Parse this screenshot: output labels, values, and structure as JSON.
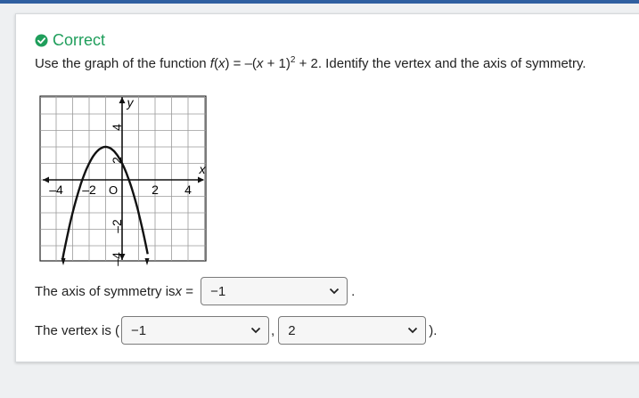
{
  "status": {
    "label": "Correct",
    "color": "#1f9e5b"
  },
  "question": {
    "prefix": "Use the graph of the function ",
    "func_name": "f",
    "func_arg": "x",
    "equals": " = –(",
    "inner_var": "x",
    "inner_rest": " + 1)",
    "exponent": "2",
    "suffix": " + 2. Identify the vertex and the axis of symmetry."
  },
  "graph": {
    "x_label": "x",
    "y_label": "y",
    "x_ticks": [
      "–4",
      "–2",
      "2",
      "4"
    ],
    "origin_label": "O",
    "y_ticks": [
      "4",
      "2",
      "–2",
      "–4"
    ]
  },
  "axis_sentence": {
    "prefix": "The axis of symmetry is ",
    "var": "x",
    "equals": " = ",
    "selected": "−1",
    "suffix": "."
  },
  "vertex_sentence": {
    "prefix": "The vertex is (",
    "x_selected": "−1",
    "comma": ",",
    "y_selected": "2",
    "suffix": ")."
  },
  "colors": {
    "header_bar": "#2f5fa0",
    "correct": "#1f9e5b"
  }
}
